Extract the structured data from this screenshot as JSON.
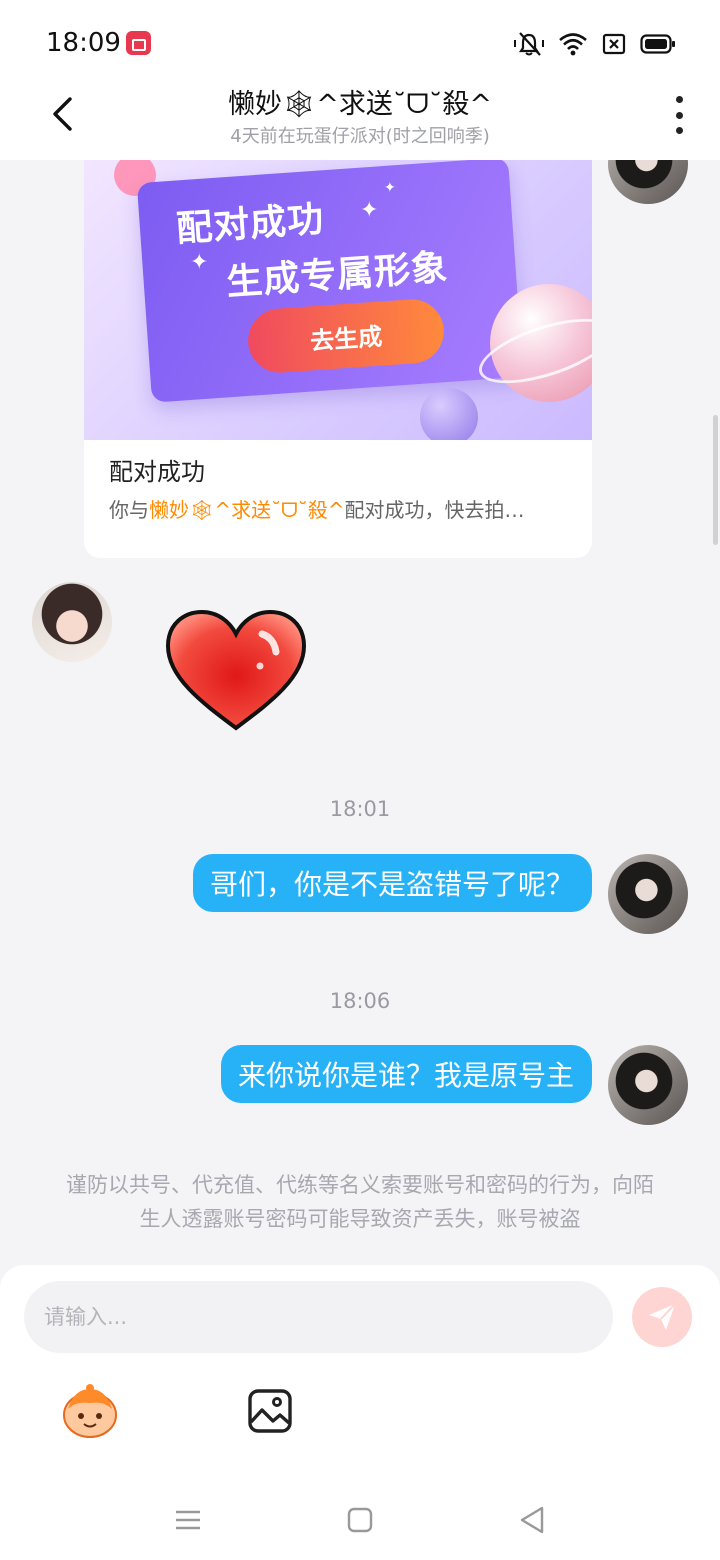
{
  "status_bar": {
    "time": "18:09",
    "icons": [
      "screen-record-icon",
      "mute-vibrate-icon",
      "wifi-icon",
      "sim-off-icon",
      "battery-icon"
    ]
  },
  "header": {
    "title": "懒妙🕸^求送˘ᗜ˘殺^",
    "subtitle": "4天前在玩蛋仔派对(时之回响季)"
  },
  "match_card": {
    "banner_line1": "配对成功",
    "banner_line2": "生成专属形象",
    "banner_button": "去生成",
    "title": "配对成功",
    "desc_prefix": "你与",
    "desc_name": "懒妙🕸^求送˘ᗜ˘殺^",
    "desc_suffix": "配对成功，快去拍…"
  },
  "messages": [
    {
      "time": "18:01",
      "text": "哥们，你是不是盗错号了呢？"
    },
    {
      "time": "18:06",
      "text": "来你说你是谁？我是原号主"
    }
  ],
  "notice": "谨防以共号、代充值、代练等名义索要账号和密码的行为，向陌生人透露账号密码可能导致资产丢失，账号被盗",
  "input": {
    "placeholder": "请输入..."
  },
  "colors": {
    "bubble": "#27b2f7",
    "highlight": "#ff8a00",
    "send_button": "#ffd5d3",
    "banner_button": "#f04a5f"
  }
}
